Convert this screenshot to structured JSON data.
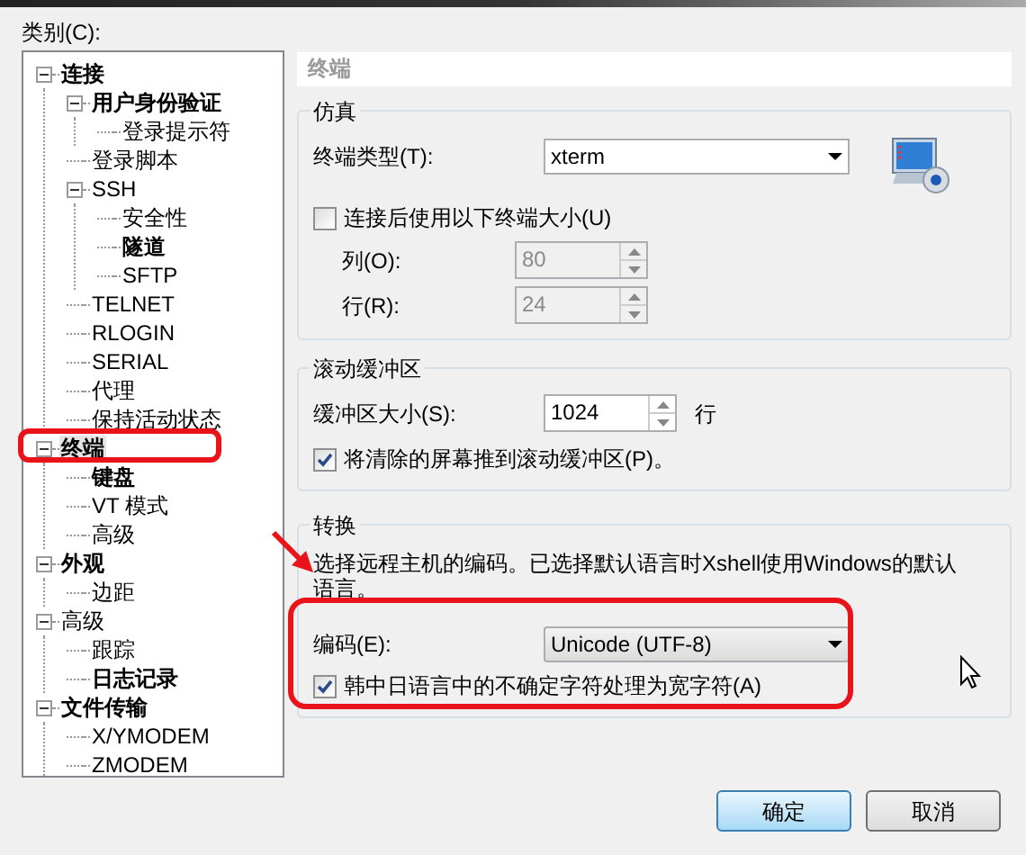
{
  "category_label": "类别(C):",
  "tree": [
    {
      "label": "连接",
      "bold": true,
      "selected": false,
      "expanded": true,
      "children": [
        {
          "label": "用户身份验证",
          "bold": true,
          "selected": false,
          "expanded": true,
          "children": [
            {
              "label": "登录提示符",
              "bold": false,
              "selected": false
            }
          ]
        },
        {
          "label": "登录脚本",
          "bold": false,
          "selected": false
        },
        {
          "label": "SSH",
          "bold": false,
          "selected": false,
          "expanded": true,
          "children": [
            {
              "label": "安全性",
              "bold": false,
              "selected": false
            },
            {
              "label": "隧道",
              "bold": true,
              "selected": false
            },
            {
              "label": "SFTP",
              "bold": false,
              "selected": false
            }
          ]
        },
        {
          "label": "TELNET",
          "bold": false,
          "selected": false
        },
        {
          "label": "RLOGIN",
          "bold": false,
          "selected": false
        },
        {
          "label": "SERIAL",
          "bold": false,
          "selected": false
        },
        {
          "label": "代理",
          "bold": false,
          "selected": false
        },
        {
          "label": "保持活动状态",
          "bold": false,
          "selected": false
        }
      ]
    },
    {
      "label": "终端",
      "bold": true,
      "selected": true,
      "expanded": true,
      "children": [
        {
          "label": "键盘",
          "bold": true,
          "selected": false
        },
        {
          "label": "VT 模式",
          "bold": false,
          "selected": false
        },
        {
          "label": "高级",
          "bold": false,
          "selected": false
        }
      ]
    },
    {
      "label": "外观",
      "bold": true,
      "selected": false,
      "expanded": true,
      "children": [
        {
          "label": "边距",
          "bold": false,
          "selected": false
        }
      ]
    },
    {
      "label": "高级",
      "bold": false,
      "selected": false,
      "expanded": true,
      "children": [
        {
          "label": "跟踪",
          "bold": false,
          "selected": false
        },
        {
          "label": "日志记录",
          "bold": true,
          "selected": false
        }
      ]
    },
    {
      "label": "文件传输",
      "bold": true,
      "selected": false,
      "expanded": true,
      "children": [
        {
          "label": "X/YMODEM",
          "bold": false,
          "selected": false
        },
        {
          "label": "ZMODEM",
          "bold": false,
          "selected": false
        }
      ]
    }
  ],
  "panel_title": "终端",
  "emulation": {
    "title": "仿真",
    "terminal_type": {
      "label": "终端类型(T):",
      "value": "xterm"
    },
    "fixed_size": {
      "label": "连接后使用以下终端大小(U)",
      "checked": false
    },
    "columns": {
      "label": "列(O):",
      "value": "80",
      "disabled": true
    },
    "rows": {
      "label": "行(R):",
      "value": "24",
      "disabled": true
    }
  },
  "scrollback": {
    "title": "滚动缓冲区",
    "size": {
      "label": "缓冲区大小(S):",
      "value": "1024",
      "unit": "行",
      "disabled": false
    },
    "push_cleared": {
      "label": "将清除的屏幕推到滚动缓冲区(P)。",
      "checked": true
    }
  },
  "translation": {
    "title": "转换",
    "description": "选择远程主机的编码。已选择默认语言时Xshell使用Windows的默认语言。",
    "encoding": {
      "label": "编码(E):",
      "value": "Unicode (UTF-8)"
    },
    "cjk_wide": {
      "label": "韩中日语言中的不确定字符处理为宽字符(A)",
      "checked": true
    }
  },
  "buttons": [
    {
      "label": "确定",
      "default": true
    },
    {
      "label": "取消",
      "default": false
    }
  ]
}
